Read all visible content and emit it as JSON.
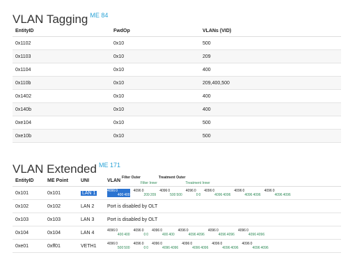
{
  "vlan_tagging": {
    "title": "VLAN Tagging",
    "badge": "ME 84",
    "headers": [
      "EntityID",
      "FwdOp",
      "VLANs (VID)"
    ],
    "rows": [
      [
        "0x1102",
        "0x10",
        "500"
      ],
      [
        "0x1103",
        "0x10",
        "209"
      ],
      [
        "0x1104",
        "0x10",
        "400"
      ],
      [
        "0x110b",
        "0x10",
        "209,400,500"
      ],
      [
        "0x1402",
        "0x10",
        "400"
      ],
      [
        "0x140b",
        "0x10",
        "400"
      ],
      [
        "0xe104",
        "0x10",
        "500"
      ],
      [
        "0xe10b",
        "0x10",
        "500"
      ]
    ]
  },
  "vlan_extended": {
    "title": "VLAN Extended",
    "badge": "ME 171",
    "headers": {
      "entity": "EntityID",
      "me_point": "ME Point",
      "uni": "UNI",
      "vlan": "VLAN",
      "filter_outer": "Filter Outer",
      "filter_inner": "Filter Inner",
      "treatment_outer": "Treatment Outer",
      "treatment_inner": "Treatment Inner"
    },
    "rows": [
      {
        "entity": "0x101",
        "me": "0x101",
        "uni": "LAN 1",
        "uni_selected": true,
        "tags": [
          [
            "4096",
            "0",
            "400",
            "400"
          ],
          [
            "4096",
            "0",
            "209",
            "209"
          ],
          [
            "4096",
            "0",
            "500",
            "500"
          ],
          [
            "4096",
            "0",
            "0",
            "0"
          ],
          [
            "4096",
            "0",
            "4096",
            "4096"
          ],
          [
            "4096",
            "0",
            "4096",
            "4096"
          ],
          [
            "4096",
            "0",
            "4096",
            "4096"
          ]
        ]
      },
      {
        "entity": "0x102",
        "me": "0x102",
        "uni": "LAN 2",
        "status": "Port is disabled by OLT"
      },
      {
        "entity": "0x103",
        "me": "0x103",
        "uni": "LAN 3",
        "status": "Port is disabled by OLT"
      },
      {
        "entity": "0x104",
        "me": "0x104",
        "uni": "LAN 4",
        "tags": [
          [
            "4096",
            "0",
            "400",
            "400"
          ],
          [
            "4096",
            "0",
            "0",
            "0"
          ],
          [
            "4096",
            "0",
            "400",
            "400"
          ],
          [
            "4096",
            "0",
            "4096",
            "4096"
          ],
          [
            "4096",
            "0",
            "4096",
            "4096"
          ],
          [
            "4096",
            "0",
            "4096",
            "4096"
          ]
        ]
      },
      {
        "entity": "0xe01",
        "me": "0xff01",
        "uni": "VETH1",
        "tags": [
          [
            "4096",
            "0",
            "500",
            "500"
          ],
          [
            "4096",
            "0",
            "0",
            "0"
          ],
          [
            "4096",
            "0",
            "4096",
            "4096"
          ],
          [
            "4096",
            "0",
            "4096",
            "4096"
          ],
          [
            "4096",
            "0",
            "4096",
            "4096"
          ],
          [
            "4096",
            "0",
            "4096",
            "4096"
          ]
        ]
      }
    ]
  }
}
